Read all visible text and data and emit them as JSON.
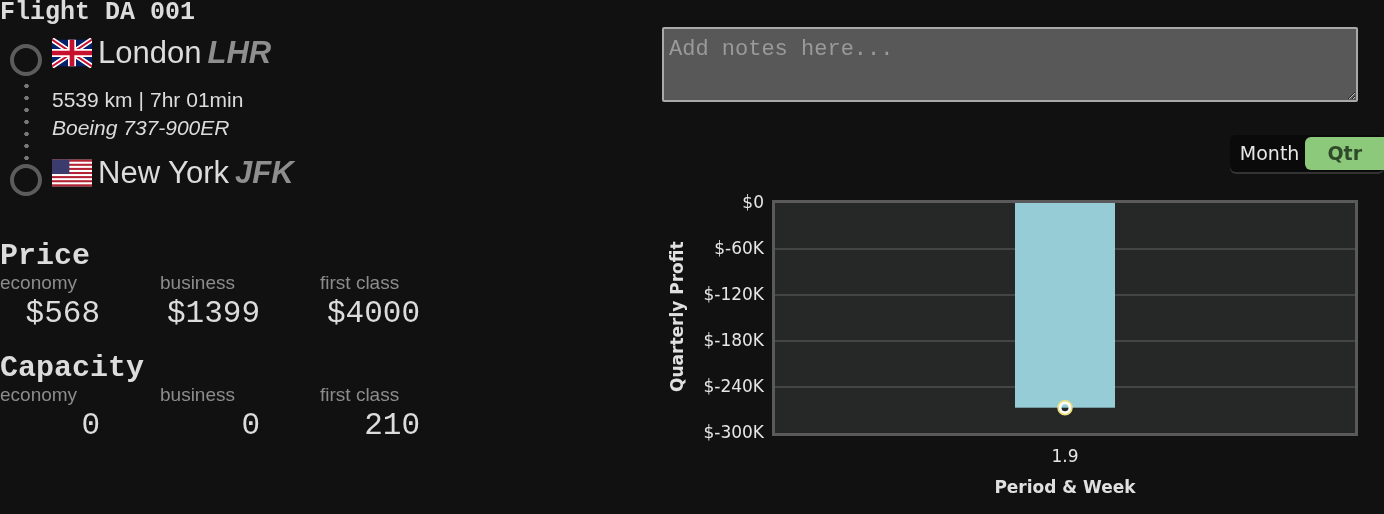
{
  "flight": {
    "title": "Flight DA 001",
    "stops": [
      {
        "kind": "uk",
        "city": "London",
        "code": "LHR"
      },
      {
        "kind": "us",
        "city": "New York",
        "code": "JFK"
      }
    ],
    "details": {
      "distance": "5539 km",
      "separator": "|",
      "duration": "7hr 01min",
      "aircraft": "Boeing 737-900ER"
    }
  },
  "price": {
    "title": "Price",
    "columns": [
      {
        "label": "economy",
        "value": "$568"
      },
      {
        "label": "business",
        "value": "$1399"
      },
      {
        "label": "first class",
        "value": "$4000"
      }
    ]
  },
  "capacity": {
    "title": "Capacity",
    "columns": [
      {
        "label": "economy",
        "value": "0"
      },
      {
        "label": "business",
        "value": "0"
      },
      {
        "label": "first class",
        "value": "210"
      }
    ]
  },
  "notes": {
    "placeholder": "Add notes here..."
  },
  "period_toggle": [
    {
      "label": "Month",
      "selected": false
    },
    {
      "label": "Qtr",
      "selected": true
    }
  ],
  "chart": {
    "chart_data": {
      "type": "bar",
      "xlabel": "Period & Week",
      "ylabel": "Quarterly Profit",
      "categories": [
        "1.9"
      ],
      "grid": true,
      "series": [
        {
          "color": "#96ccd6",
          "values": [
            -267000
          ]
        }
      ],
      "ylim": [
        -300000,
        0
      ],
      "yticks": [
        {
          "value": 0,
          "label": "$0"
        },
        {
          "value": -60000,
          "label": "$-60K"
        },
        {
          "value": -120000,
          "label": "$-120K"
        },
        {
          "value": -180000,
          "label": "$-180K"
        },
        {
          "value": -240000,
          "label": "$-240K"
        },
        {
          "value": -300000,
          "label": "$-300K"
        }
      ]
    }
  }
}
